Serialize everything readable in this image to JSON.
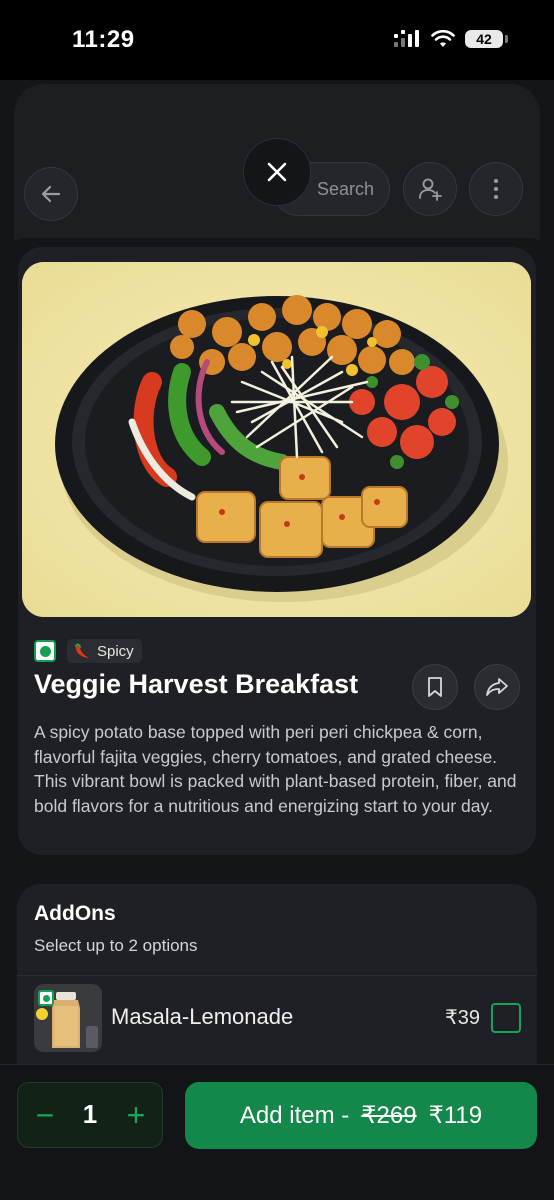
{
  "status_bar": {
    "time": "11:29",
    "battery": "42"
  },
  "header": {
    "search_placeholder": "Search"
  },
  "item": {
    "tag": "Spicy",
    "title": "Veggie Harvest Breakfast",
    "description": "A spicy potato base topped with peri peri chickpea & corn, flavorful fajita veggies, cherry tomatoes, and grated cheese. This vibrant bowl is packed with plant-based protein, fiber, and bold flavors for a nutritious and energizing start to your day."
  },
  "addons": {
    "title": "AddOns",
    "subtitle": "Select up to 2 options",
    "items": [
      {
        "name": "Masala-Lemonade",
        "price": "₹39",
        "selected": false
      }
    ]
  },
  "cart": {
    "quantity": "1",
    "minus_symbol": "−",
    "plus_symbol": "+",
    "add_label": "Add item -",
    "original_price": "₹269",
    "price": "₹119"
  },
  "colors": {
    "accent_green": "#13884a",
    "veg_green": "#14a052",
    "background": "#141519",
    "card": "#1e2025"
  }
}
